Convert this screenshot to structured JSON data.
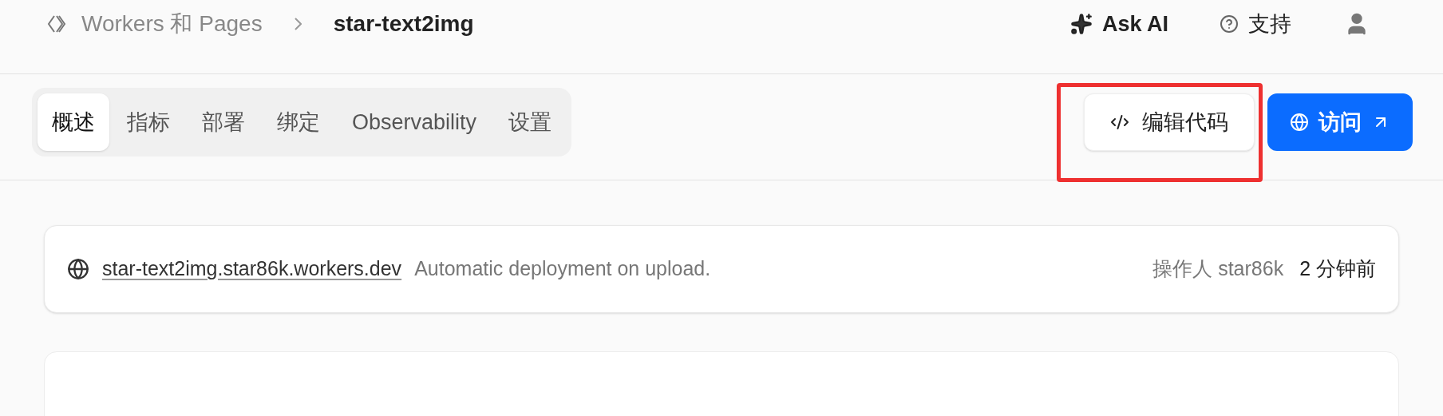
{
  "breadcrumb": {
    "parent": "Workers 和 Pages",
    "current": "star-text2img"
  },
  "header_actions": [
    {
      "kind": "ai",
      "label": "Ask AI"
    },
    {
      "kind": "help",
      "label": "支持"
    },
    {
      "kind": "user"
    }
  ],
  "tabs": [
    {
      "label": "概述",
      "selected": true
    },
    {
      "label": "指标",
      "selected": false
    },
    {
      "label": "部署",
      "selected": false
    },
    {
      "label": "绑定",
      "selected": false
    },
    {
      "label": "Observability",
      "selected": false
    },
    {
      "label": "设置",
      "selected": false
    }
  ],
  "actions": [
    {
      "kind": "code",
      "label": "编辑代码",
      "highlighted": true
    },
    {
      "kind": "visit",
      "label": "访问",
      "highlighted": false
    }
  ],
  "deployment": {
    "url": "star-text2img.star86k.workers.dev",
    "message": "Automatic deployment on upload.",
    "author": "操作人 star86k",
    "time": "2 分钟前"
  }
}
